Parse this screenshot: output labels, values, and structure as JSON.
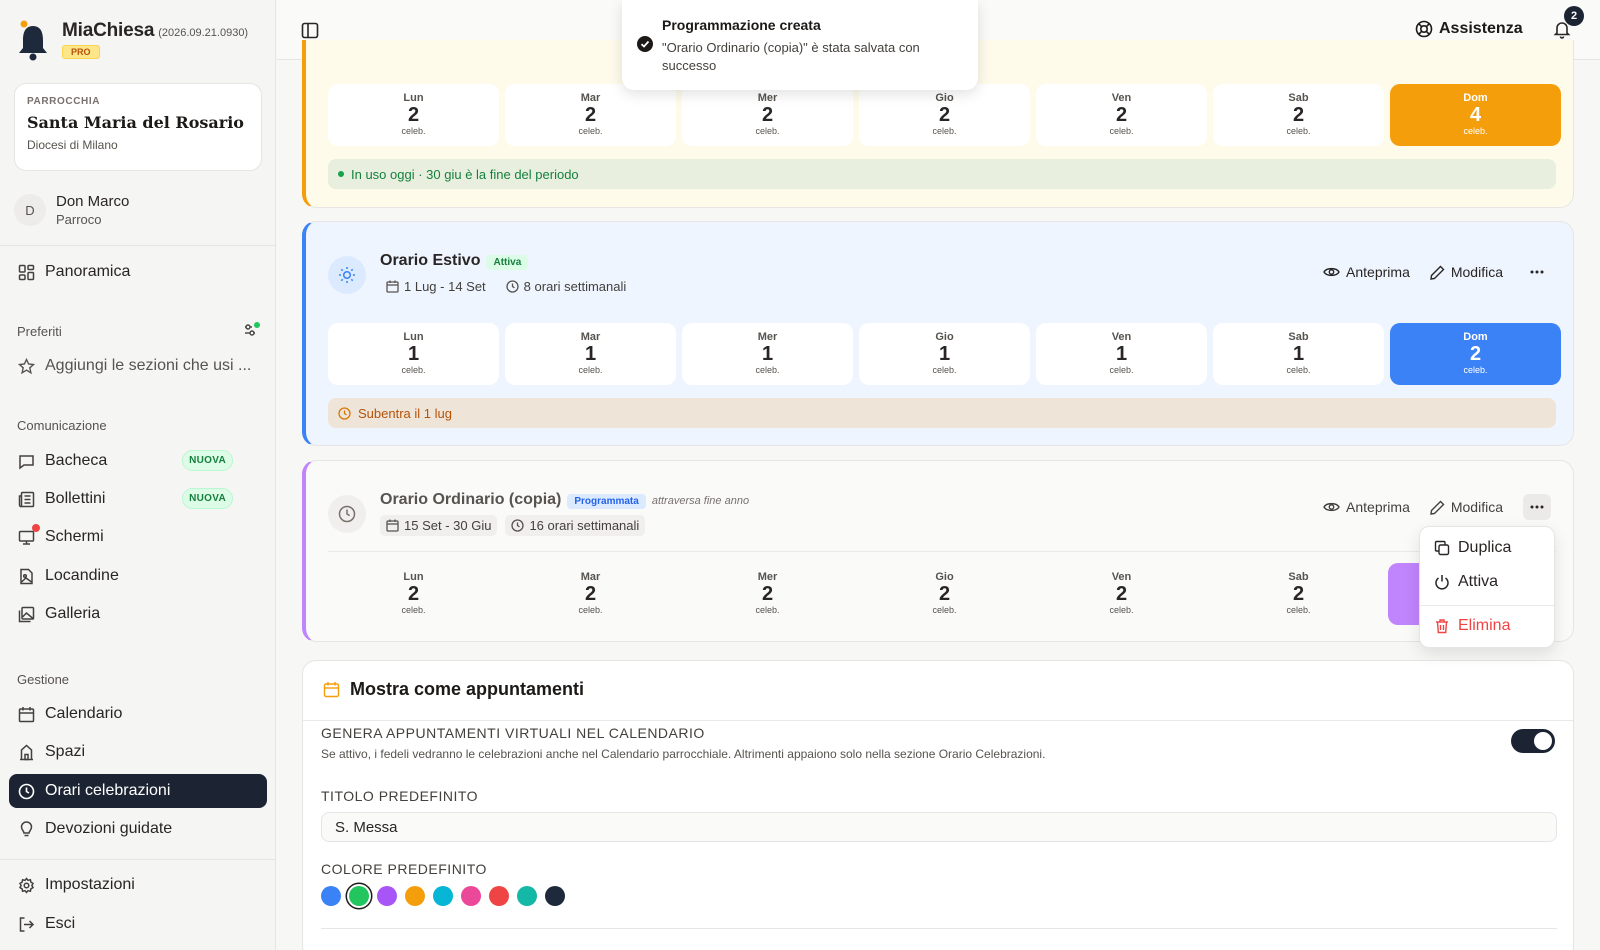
{
  "app": {
    "name": "MiaChiesa",
    "version": "(2026.09.21.0930)",
    "plan": "PRO"
  },
  "parish": {
    "label": "PARROCCHIA",
    "name": "Santa Maria del Rosario",
    "diocese": "Diocesi di Milano"
  },
  "user": {
    "initial": "D",
    "name": "Don Marco",
    "role": "Parroco"
  },
  "nav": {
    "overview": "Panoramica",
    "favorites_title": "Preferiti",
    "favorites_hint": "Aggiungi le sezioni che usi ...",
    "communication_title": "Comunicazione",
    "board": "Bacheca",
    "board_badge": "NUOVA",
    "bulletins": "Bollettini",
    "bulletins_badge": "NUOVA",
    "screens": "Schermi",
    "posters": "Locandine",
    "gallery": "Galleria",
    "management_title": "Gestione",
    "calendar": "Calendario",
    "spaces": "Spazi",
    "schedules": "Orari celebrazioni",
    "devotions": "Devozioni guidate",
    "settings": "Impostazioni",
    "logout": "Esci"
  },
  "topbar": {
    "help": "Assistenza",
    "notif_count": "2"
  },
  "toast": {
    "title": "Programmazione creata",
    "message": "\"Orario Ordinario (copia)\" è stata salvata con successo"
  },
  "schedules": [
    {
      "days": [
        {
          "d": "Lun",
          "c": "2"
        },
        {
          "d": "Mar",
          "c": "2"
        },
        {
          "d": "Mer",
          "c": "2"
        },
        {
          "d": "Gio",
          "c": "2"
        },
        {
          "d": "Ven",
          "c": "2"
        },
        {
          "d": "Sab",
          "c": "2"
        },
        {
          "d": "Dom",
          "c": "4"
        }
      ],
      "unit": "celeb.",
      "status": "In uso oggi · 30 giu è la fine del periodo",
      "accent": "#f59e0b"
    },
    {
      "title": "Orario Estivo",
      "tag": "Attiva",
      "period": "1 Lug - 14 Set",
      "count": "8 orari settimanali",
      "preview": "Anteprima",
      "edit": "Modifica",
      "days": [
        {
          "d": "Lun",
          "c": "1"
        },
        {
          "d": "Mar",
          "c": "1"
        },
        {
          "d": "Mer",
          "c": "1"
        },
        {
          "d": "Gio",
          "c": "1"
        },
        {
          "d": "Ven",
          "c": "1"
        },
        {
          "d": "Sab",
          "c": "1"
        },
        {
          "d": "Dom",
          "c": "2"
        }
      ],
      "unit": "celeb.",
      "status": "Subentra il 1 lug",
      "accent": "#3b82f6"
    },
    {
      "title": "Orario Ordinario (copia)",
      "tag": "Programmata",
      "note": "attraversa fine anno",
      "period": "15 Set - 30 Giu",
      "count": "16 orari settimanali",
      "preview": "Anteprima",
      "edit": "Modifica",
      "days": [
        {
          "d": "Lun",
          "c": "2"
        },
        {
          "d": "Mar",
          "c": "2"
        },
        {
          "d": "Mer",
          "c": "2"
        },
        {
          "d": "Gio",
          "c": "2"
        },
        {
          "d": "Ven",
          "c": "2"
        },
        {
          "d": "Sab",
          "c": "2"
        }
      ],
      "unit": "celeb.",
      "accent": "#c084fc"
    }
  ],
  "menu": {
    "duplicate": "Duplica",
    "activate": "Attiva",
    "delete": "Elimina"
  },
  "appointments": {
    "title": "Mostra come appuntamenti",
    "virtual_label": "GENERA APPUNTAMENTI VIRTUALI NEL CALENDARIO",
    "virtual_help": "Se attivo, i fedeli vedranno le celebrazioni anche nel Calendario parrocchiale. Altrimenti appaiono solo nella sezione Orario Celebrazioni.",
    "virtual_on": true,
    "default_title_label": "TITOLO PREDEFINITO",
    "default_title_value": "S. Messa",
    "default_color_label": "COLORE PREDEFINITO",
    "colors": [
      "#3b82f6",
      "#22c55e",
      "#a855f7",
      "#f59e0b",
      "#06b6d4",
      "#ec4899",
      "#ef4444",
      "#14b8a6",
      "#1e293b"
    ],
    "selected_color": "#22c55e"
  }
}
